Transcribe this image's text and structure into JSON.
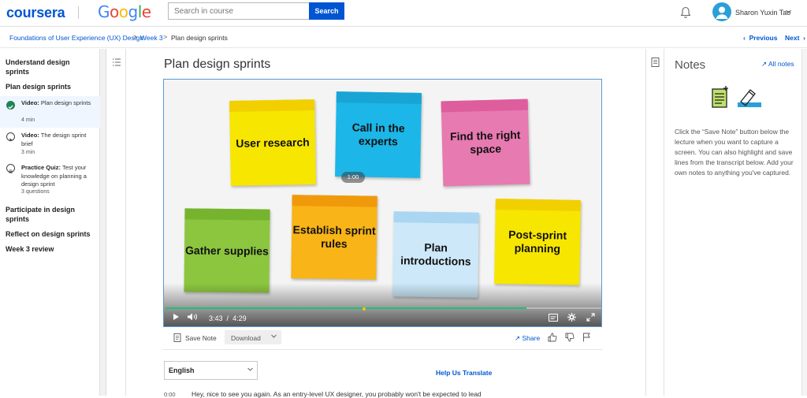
{
  "header": {
    "brand": "coursera",
    "partner": "Google",
    "search_placeholder": "Search in course",
    "search_button": "Search",
    "user_name": "Sharon Yuxin Tao",
    "bell_icon": "bell-icon",
    "avatar_icon": "user-avatar-icon",
    "caret_icon": "chevron-down-icon"
  },
  "breadcrumb": {
    "course": "Foundations of User Experience (UX) Design",
    "week": "Week 3",
    "current": "Plan design sprints",
    "sep": ">"
  },
  "pager": {
    "previous": "Previous",
    "next": "Next"
  },
  "sidebar": {
    "sections": [
      {
        "title": "Understand design sprints"
      },
      {
        "title": "Plan design sprints"
      }
    ],
    "items": [
      {
        "kind": "Video:",
        "title": "Plan design sprints",
        "meta": "4 min",
        "status": "completed",
        "icon": "check-circle-icon"
      },
      {
        "kind": "Video:",
        "title": "The design sprint brief",
        "meta": "3 min",
        "status": "not-started",
        "icon": "play-circle-icon"
      },
      {
        "kind": "Practice Quiz:",
        "title": "Test your knowledge on planning a design sprint",
        "meta": "3 questions",
        "status": "not-started",
        "icon": "quiz-icon"
      }
    ],
    "more_sections": [
      {
        "title": "Participate in design sprints"
      },
      {
        "title": "Reflect on design sprints"
      },
      {
        "title": "Week 3 review"
      }
    ]
  },
  "lesson": {
    "title": "Plan design sprints"
  },
  "video": {
    "sticky_notes": [
      {
        "text": "User research",
        "color": "#f7e600",
        "top_color": "#f2d000"
      },
      {
        "text": "Call in the experts",
        "color": "#1cb6e8",
        "top_color": "#19a4d6"
      },
      {
        "text": "Find the right space",
        "color": "#e77ab0",
        "top_color": "#de5d9d"
      },
      {
        "text": "Gather supplies",
        "color": "#8cc63f",
        "top_color": "#76b42d"
      },
      {
        "text": "Establish sprint rules",
        "color": "#f9b418",
        "top_color": "#f09a0b"
      },
      {
        "text": "Plan introductions",
        "color": "#cde8f8",
        "top_color": "#aad6f1"
      },
      {
        "text": "Post-sprint planning",
        "color": "#f7e600",
        "top_color": "#f2d000"
      }
    ],
    "hover_time": "1:00",
    "current_time": "3:43",
    "time_sep": "/",
    "duration": "4:29",
    "progress": 0.829,
    "accent": "#1fc176"
  },
  "actions": {
    "save_note": "Save Note",
    "download": "Download",
    "share": "Share"
  },
  "transcript": {
    "language": "English",
    "help_translate": "Help Us Translate",
    "first_time": "0:00",
    "first_line": "Hey, nice to see you again. As an entry-level UX designer, you probably won't be expected to lead"
  },
  "notes": {
    "title": "Notes",
    "all_notes": "All notes",
    "description": "Click the “Save Note” button below the lecture when you want to capture a screen. You can also highlight and save lines from the transcript below. Add your own notes to anything you've captured."
  }
}
